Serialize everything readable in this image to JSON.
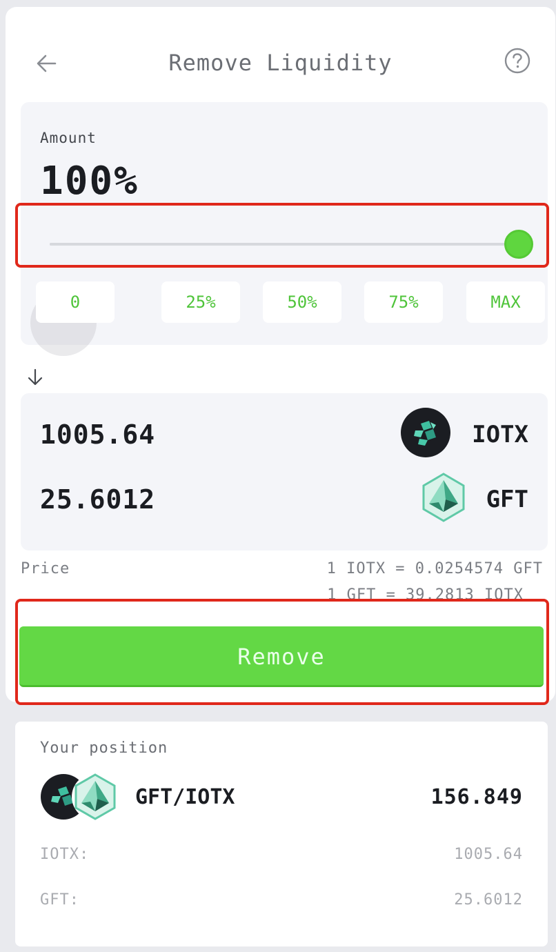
{
  "header": {
    "title": "Remove Liquidity"
  },
  "amount": {
    "label": "Amount",
    "value": "100%",
    "slider_level": 1.0,
    "presets": [
      "0",
      "25%",
      "50%",
      "75%",
      "MAX"
    ]
  },
  "output": {
    "tokens": [
      {
        "amount": "1005.64",
        "symbol": "IOTX",
        "icon": "iotx-token-icon"
      },
      {
        "amount": "25.6012",
        "symbol": "GFT",
        "icon": "gft-token-icon"
      }
    ]
  },
  "price": {
    "label": "Price",
    "lines": [
      "1 IOTX = 0.0254574 GFT",
      "1 GFT = 39.2813 IOTX"
    ]
  },
  "action": {
    "remove_label": "Remove"
  },
  "position": {
    "title": "Your position",
    "pair": "GFT/IOTX",
    "balance": "156.849",
    "rows": [
      {
        "label": "IOTX:",
        "value": "1005.64"
      },
      {
        "label": "GFT:",
        "value": "25.6012"
      }
    ]
  },
  "colors": {
    "accent": "#63d845",
    "highlight": "#e0281b",
    "panel": "#f4f5f9",
    "iotx_bg": "#1b1d22",
    "gft_teal": "#3fbf9f"
  }
}
